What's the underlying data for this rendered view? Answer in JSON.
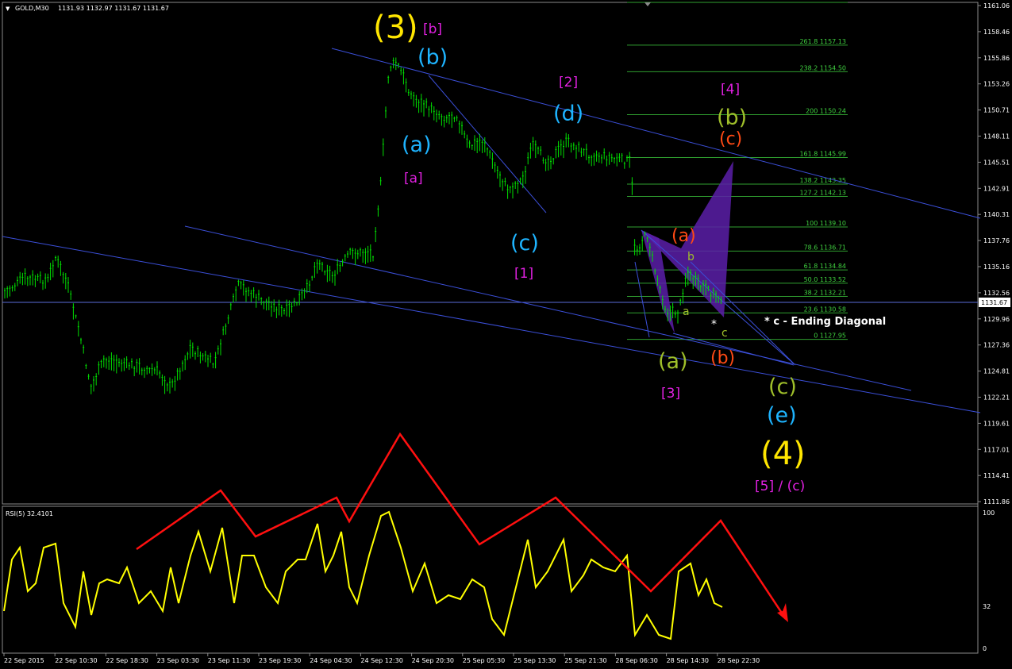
{
  "header": {
    "symbol": "GOLD,M30",
    "ohlc": "1131.93 1132.97 1131.67 1131.67",
    "current_price": "1131.67"
  },
  "price_axis": {
    "labels": [
      "1161.06",
      "1158.46",
      "1155.86",
      "1153.26",
      "1150.71",
      "1148.11",
      "1145.51",
      "1142.91",
      "1140.31",
      "1137.76",
      "1135.16",
      "1132.56",
      "1129.96",
      "1127.36",
      "1124.81",
      "1122.21",
      "1119.61",
      "1117.01",
      "1114.41",
      "1111.86"
    ]
  },
  "time_axis": {
    "labels": [
      "22 Sep 2015",
      "22 Sep 10:30",
      "22 Sep 18:30",
      "23 Sep 03:30",
      "23 Sep 11:30",
      "23 Sep 19:30",
      "24 Sep 04:30",
      "24 Sep 12:30",
      "24 Sep 20:30",
      "25 Sep 05:30",
      "25 Sep 13:30",
      "25 Sep 21:30",
      "28 Sep 06:30",
      "28 Sep 14:30",
      "28 Sep 22:30"
    ]
  },
  "fib_levels": [
    {
      "label": "261.8 1157.13",
      "price": 1157.13
    },
    {
      "label": "238.2 1154.50",
      "price": 1154.5
    },
    {
      "label": "200 1150.24",
      "price": 1150.24
    },
    {
      "label": "161.8 1145.99",
      "price": 1145.99
    },
    {
      "label": "138.2 1143.35",
      "price": 1143.35
    },
    {
      "label": "127.2 1142.13",
      "price": 1142.13
    },
    {
      "label": "100 1139.10",
      "price": 1139.1
    },
    {
      "label": "78.6 1136.71",
      "price": 1136.71
    },
    {
      "label": "61.8 1134.84",
      "price": 1134.84
    },
    {
      "label": "50.0 1133.52",
      "price": 1133.52
    },
    {
      "label": "38.2 1132.21",
      "price": 1132.21
    },
    {
      "label": "23.6 1130.58",
      "price": 1130.58
    },
    {
      "label": "0 1127.95",
      "price": 1127.95
    }
  ],
  "rsi": {
    "title": "RSI(5) 32.4101",
    "axis_labels": [
      "100",
      "32",
      "0"
    ]
  },
  "wave_labels": {
    "w3": "(3)",
    "b_top": "[b]",
    "b_cyan_top": "(b)",
    "a_cyan": "(a)",
    "a_mag": "[a]",
    "c_cyan": "(c)",
    "one_mag": "[1]",
    "two_mag": "[2]",
    "d_cyan": "(d)",
    "four_mag": "[4]",
    "b_olive": "(b)",
    "c_orange": "(c)",
    "a_orange": "(a)",
    "b_small": "b",
    "a_small": "a",
    "c_small": "c",
    "star": "*",
    "a_olive": "(a)",
    "b_orange": "(b)",
    "three_mag": "[3]",
    "c_olive": "(c)",
    "e_cyan": "(e)",
    "w4": "(4)",
    "five_c": "[5] / (c)",
    "ending_diag": "* c -  Ending Diagonal"
  },
  "colors": {
    "candle": "#00e000",
    "trend": "#3b4fd8",
    "rsi": "#ffff00",
    "arrow": "#ff0000",
    "fib": "#2f9f2f",
    "pattern": "#5b1fa8",
    "yellow": "#ffe600",
    "magenta": "#e020e0",
    "cyan": "#1eb4ff",
    "olive": "#9fbf2a",
    "orange": "#ff4a14"
  }
}
